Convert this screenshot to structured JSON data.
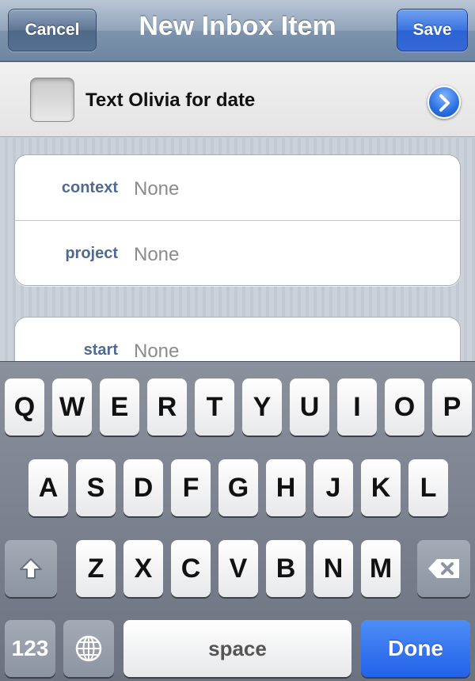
{
  "navbar": {
    "title": "New Inbox Item",
    "cancel_label": "Cancel",
    "save_label": "Save"
  },
  "item": {
    "title": "Text Olivia for date",
    "checked": false
  },
  "fields": [
    {
      "label": "context",
      "value": "None"
    },
    {
      "label": "project",
      "value": "None"
    },
    {
      "label": "start",
      "value": "None"
    }
  ],
  "keyboard": {
    "row1": [
      "Q",
      "W",
      "E",
      "R",
      "T",
      "Y",
      "U",
      "I",
      "O",
      "P"
    ],
    "row2": [
      "A",
      "S",
      "D",
      "F",
      "G",
      "H",
      "J",
      "K",
      "L"
    ],
    "row3": [
      "Z",
      "X",
      "C",
      "V",
      "B",
      "N",
      "M"
    ],
    "numbers_label": "123",
    "space_label": "space",
    "done_label": "Done"
  },
  "colors": {
    "label_blue": "#4f6a92",
    "value_gray": "#8b8b8b",
    "done_blue": "#2361e8"
  },
  "icons": {
    "disclosure": "disclosure-chevron-icon",
    "shift": "shift-arrow-icon",
    "backspace": "backspace-icon",
    "globe": "globe-icon"
  }
}
